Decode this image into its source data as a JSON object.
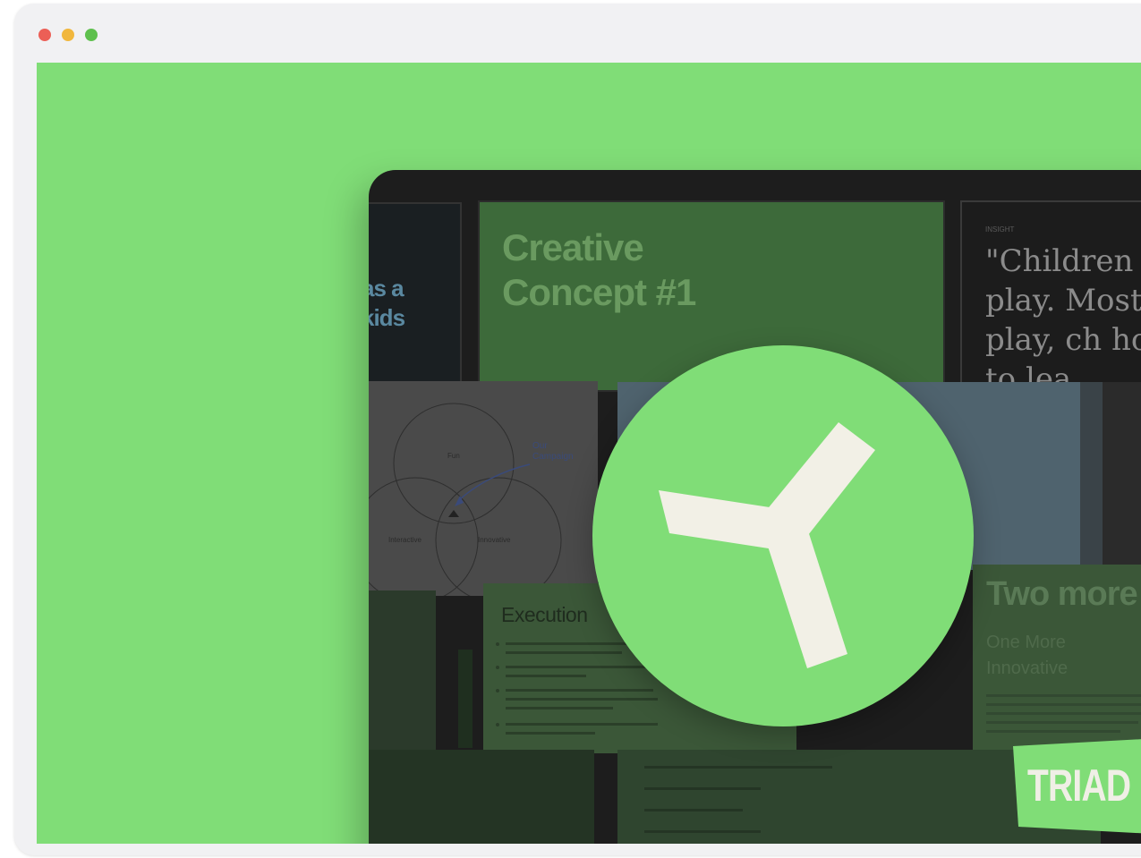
{
  "window": {
    "controls": [
      "close",
      "minimize",
      "zoom"
    ],
    "colors": {
      "close": "#ec5f56",
      "minimize": "#f1b73d",
      "zoom": "#5ec04d"
    }
  },
  "canvas": {
    "background": "#80dd77"
  },
  "board": {
    "cards": {
      "left_text": "as a kids",
      "creative_title": "Creative Concept #1",
      "quote_label": "INSIGHT",
      "quote_text": "\"Children play. Most in play, ch how to lea",
      "venn_labels": {
        "top": "Fun",
        "left": "Interactive",
        "right": "Innovative",
        "note": "Our Campaign"
      },
      "execution_title": "Execution",
      "two_more_title": "Two more",
      "two_more_subtitle": "One More Innovative"
    }
  },
  "logo": {
    "icon": "triad-y-logo-icon",
    "circle_color": "#80dd77",
    "mark_color": "#f2f0e6"
  },
  "badge": {
    "label": "TRIAD",
    "color": "#80dd77"
  }
}
